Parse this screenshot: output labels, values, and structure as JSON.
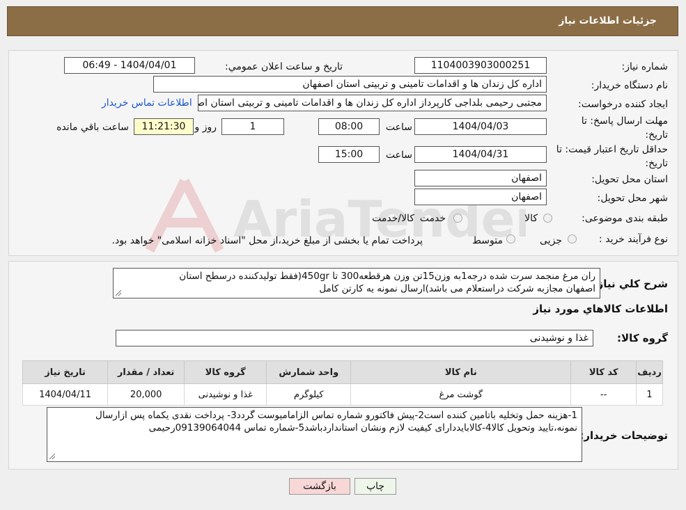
{
  "header": {
    "title": "جزئیات اطلاعات نیاز"
  },
  "form": {
    "need_number": {
      "label": "شماره نیاز:",
      "value": "1104003903000251"
    },
    "announce_datetime": {
      "label": "تاریخ و ساعت اعلان عمومي:",
      "value": "1404/04/01 - 06:49"
    },
    "buyer_org": {
      "label": "نام دستگاه خريدار:",
      "value": "اداره کل زندان ها و اقدامات تامینی و تربیتی استان اصفهان"
    },
    "requester": {
      "label": "ايجاد کننده درخواست:",
      "value": "مجتبی رحیمی بلداجی کارپرداز اداره کل زندان ها و اقدامات تامینی و تربیتی استان اصفهان",
      "contact_link": "اطلاعات تماس خريدار"
    },
    "reply_deadline": {
      "label": "مهلت ارسال پاسخ: تا تاریخ:",
      "date": "1404/04/03",
      "time_label": "ساعت",
      "time": "08:00",
      "days": "1",
      "days_label": "روز و",
      "remaining": "11:21:30",
      "remaining_label": "ساعت باقي مانده"
    },
    "price_validity": {
      "label": "حداقل تاريخ اعتبار قيمت: تا تاريخ:",
      "date": "1404/04/31",
      "time_label": "ساعت",
      "time": "15:00"
    },
    "delivery_province": {
      "label": "استان محل تحويل:",
      "value": "اصفهان"
    },
    "delivery_city": {
      "label": "شهر محل تحويل:",
      "value": "اصفهان"
    },
    "category": {
      "label": "طبقه بندی موضوعی:",
      "options": [
        "کالا",
        "خدمت",
        "کالا/خدمت"
      ]
    },
    "process_type": {
      "label": "نوع فرآیند خرید :",
      "options": [
        "جزیی",
        "متوسط"
      ],
      "note": "پرداخت تمام یا بخشی از مبلغ خرید،از محل \"اسناد خزانه اسلامی\" خواهد بود."
    }
  },
  "description": {
    "label": "شرح کلي نياز:",
    "line1": "ران مرغ منجمد سرت شده درجه1به وزن15تن وزن هرقطعه300 تا 450gr(فقط تولیدکننده درسطح استان",
    "line2": "اصفهان مجازبه شرکت دراستعلام می باشد)ارسال نمونه یه کارتن کامل"
  },
  "goods_info": {
    "title": "اطلاعات کالاهاي مورد نياز"
  },
  "goods_group": {
    "label": "گروه کالا:",
    "value": "غذا و نوشیدنی"
  },
  "table": {
    "headers": [
      "رديف",
      "کد کالا",
      "نام کالا",
      "واحد شمارش",
      "گروه کالا",
      "تعداد / مقدار",
      "تاريخ نياز"
    ],
    "rows": [
      [
        "1",
        "--",
        "گوشت مرغ",
        "کیلوگرم",
        "غذا و نوشیدنی",
        "20,000",
        "1404/04/11"
      ]
    ]
  },
  "buyer_notes": {
    "label": "توضيحات خريدار:",
    "line1": "1-هزینه حمل وتخلیه باتامین کننده است2-پیش فاکتورو شماره تماس الزامامیوست گردد3- پرداخت نقدی یکماه  پس ازارسال",
    "line2": "نمونه،تایید وتحویل کالا4-کالابایددارای کیفیت لازم ونشان استانداردباشد5-شماره تماس 09139064044رحیمی"
  },
  "buttons": {
    "print": "چاپ",
    "back": "بازگشت"
  },
  "watermark": {
    "text": "AriaTender.neT"
  },
  "colors": {
    "titlebar": "#8b6d46",
    "link": "#1a56c8",
    "back_button": "#f8d7d7",
    "print_button": "#eef6ea",
    "timer_bg": "#ffffcc"
  }
}
